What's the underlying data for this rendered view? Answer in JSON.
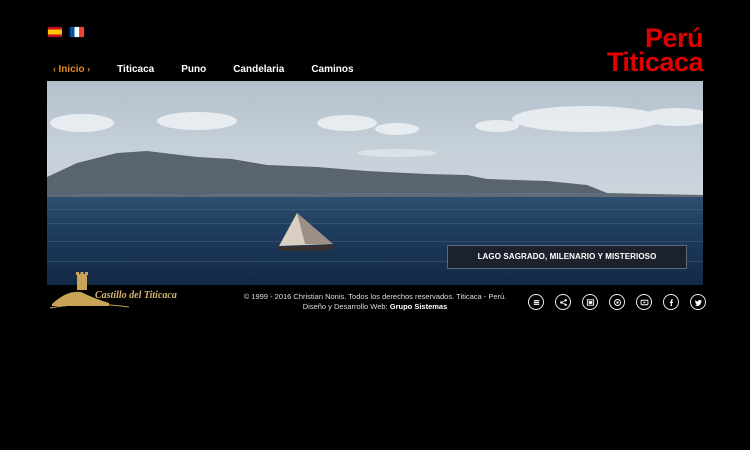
{
  "languages": {
    "es": "Español",
    "fr": "Français"
  },
  "logo": {
    "line1": "Perú",
    "line2": "Titicaca",
    "color": "#e00000"
  },
  "nav": {
    "items": [
      {
        "label": "Inicio",
        "active": true
      },
      {
        "label": "Titicaca"
      },
      {
        "label": "Puno"
      },
      {
        "label": "Candelaria"
      },
      {
        "label": "Caminos"
      }
    ],
    "active_color": "#e08a1e"
  },
  "hero": {
    "caption": "LAGO SAGRADO, MILENARIO Y MISTERIOSO"
  },
  "footer": {
    "brand": "Castillo del Titicaca",
    "copyright": "© 1999 - 2016 Christian Nonis. Todos los derechos reservados. Titicaca - Perú.",
    "credits_prefix": "Diseño y Desarrollo Web:",
    "credits_link": "Grupo Sistemas"
  },
  "social_icons": [
    "menu-icon",
    "share-icon",
    "gallery-icon",
    "email-icon",
    "video-icon",
    "facebook-icon",
    "twitter-icon"
  ]
}
